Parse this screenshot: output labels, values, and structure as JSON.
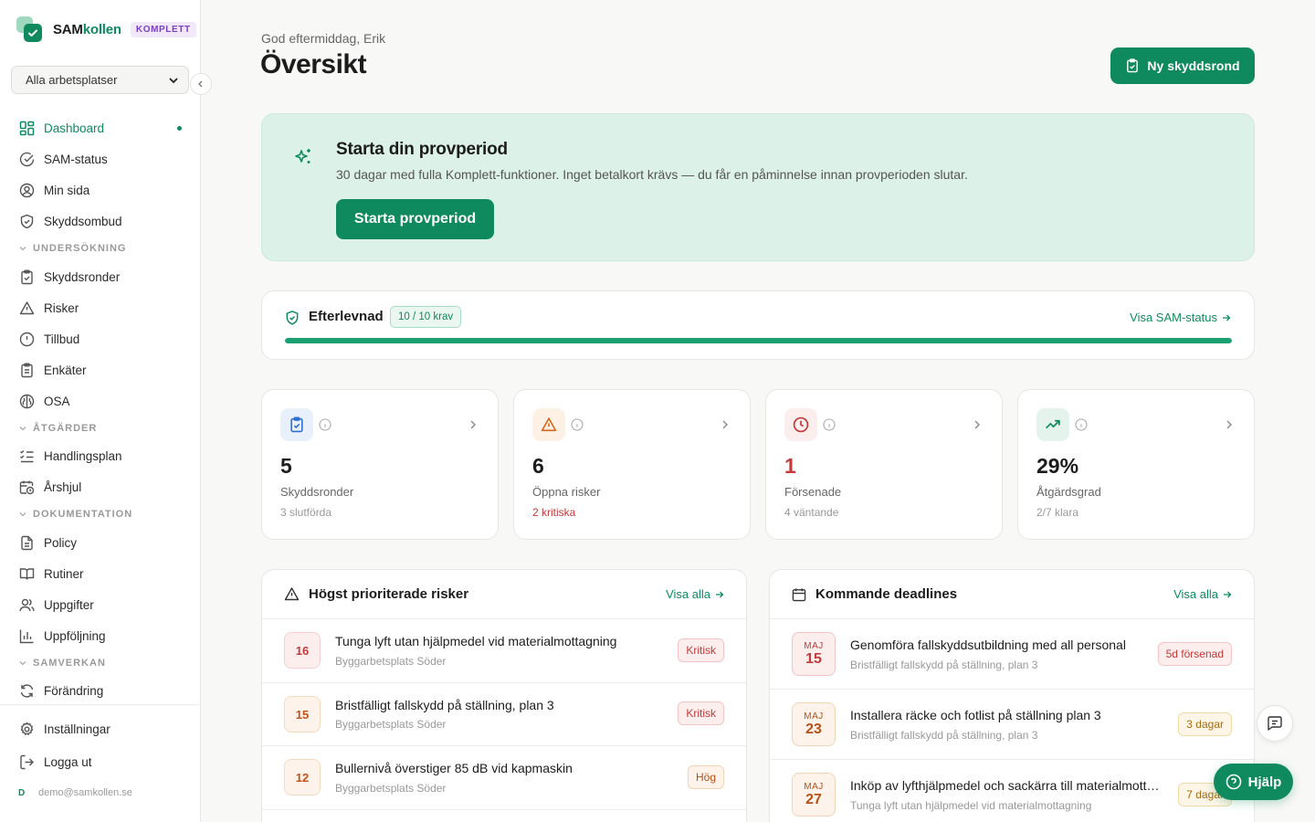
{
  "brand": {
    "name_a": "SAM",
    "name_b": "kollen",
    "plan": "KOMPLETT"
  },
  "workspace_select": {
    "value": "Alla arbetsplatser"
  },
  "nav": {
    "dashboard": "Dashboard",
    "sam_status": "SAM-status",
    "min_sida": "Min sida",
    "skyddsombud": "Skyddsombud",
    "section_undersokning": "UNDERSÖKNING",
    "skyddsronder": "Skyddsronder",
    "risker": "Risker",
    "tillbud": "Tillbud",
    "enkater": "Enkäter",
    "osa": "OSA",
    "section_atgarder": "ÅTGÄRDER",
    "handlingsplan": "Handlingsplan",
    "arshjul": "Årshjul",
    "section_dokumentation": "DOKUMENTATION",
    "policy": "Policy",
    "rutiner": "Rutiner",
    "uppgifter": "Uppgifter",
    "uppfoljning": "Uppföljning",
    "section_samverkan": "SAMVERKAN",
    "forandring": "Förändring",
    "installningar": "Inställningar",
    "logga_ut": "Logga ut"
  },
  "user": {
    "initial": "D",
    "email": "demo@samkollen.se"
  },
  "header": {
    "greeting": "God eftermiddag, Erik",
    "title": "Översikt",
    "new_round_button": "Ny skyddsrond"
  },
  "trial": {
    "title": "Starta din provperiod",
    "text": "30 dagar med fulla Komplett-funktioner. Inget betalkort krävs — du får en påminnelse innan provperioden slutar.",
    "button": "Starta provperiod"
  },
  "compliance": {
    "label": "Efterlevnad",
    "badge": "10 / 10 krav",
    "link": "Visa SAM-status",
    "progress": 1.0
  },
  "stats": [
    {
      "value": "5",
      "label": "Skyddsronder",
      "sub": "3 slutförda"
    },
    {
      "value": "6",
      "label": "Öppna risker",
      "sub": "2 kritiska"
    },
    {
      "value": "1",
      "label": "Försenade",
      "sub": "4 väntande"
    },
    {
      "value": "29%",
      "label": "Åtgärdsgrad",
      "sub": "2/7 klara"
    }
  ],
  "risks": {
    "title": "Högst prioriterade risker",
    "link": "Visa alla",
    "items": [
      {
        "score": "16",
        "title": "Tunga lyft utan hjälpmedel vid materialmottagning",
        "site": "Byggarbetsplats Söder",
        "level": "Kritisk"
      },
      {
        "score": "15",
        "title": "Bristfälligt fallskydd på ställning, plan 3",
        "site": "Byggarbetsplats Söder",
        "level": "Kritisk"
      },
      {
        "score": "12",
        "title": "Bullernivå överstiger 85 dB vid kapmaskin",
        "site": "Byggarbetsplats Söder",
        "level": "Hög"
      }
    ]
  },
  "deadlines": {
    "title": "Kommande deadlines",
    "link": "Visa alla",
    "items": [
      {
        "month": "MAJ",
        "day": "15",
        "title": "Genomföra fallskyddsutbildning med all personal",
        "sub": "Bristfälligt fallskydd på ställning, plan 3",
        "status": "5d försenad"
      },
      {
        "month": "MAJ",
        "day": "23",
        "title": "Installera räcke och fotlist på ställning plan 3",
        "sub": "Bristfälligt fallskydd på ställning, plan 3",
        "status": "3 dagar"
      },
      {
        "month": "MAJ",
        "day": "27",
        "title": "Inköp av lyfthjälpmedel och sackärra till materialmott…",
        "sub": "Tunga lyft utan hjälpmedel vid materialmottagning",
        "status": "7 dagar"
      }
    ]
  },
  "help": {
    "label": "Hjälp"
  },
  "colors": {
    "brand_green": "#0f8a5f",
    "critical": "#c23a3a",
    "high": "#b65016",
    "trial_bg": "#dcf1e7"
  }
}
